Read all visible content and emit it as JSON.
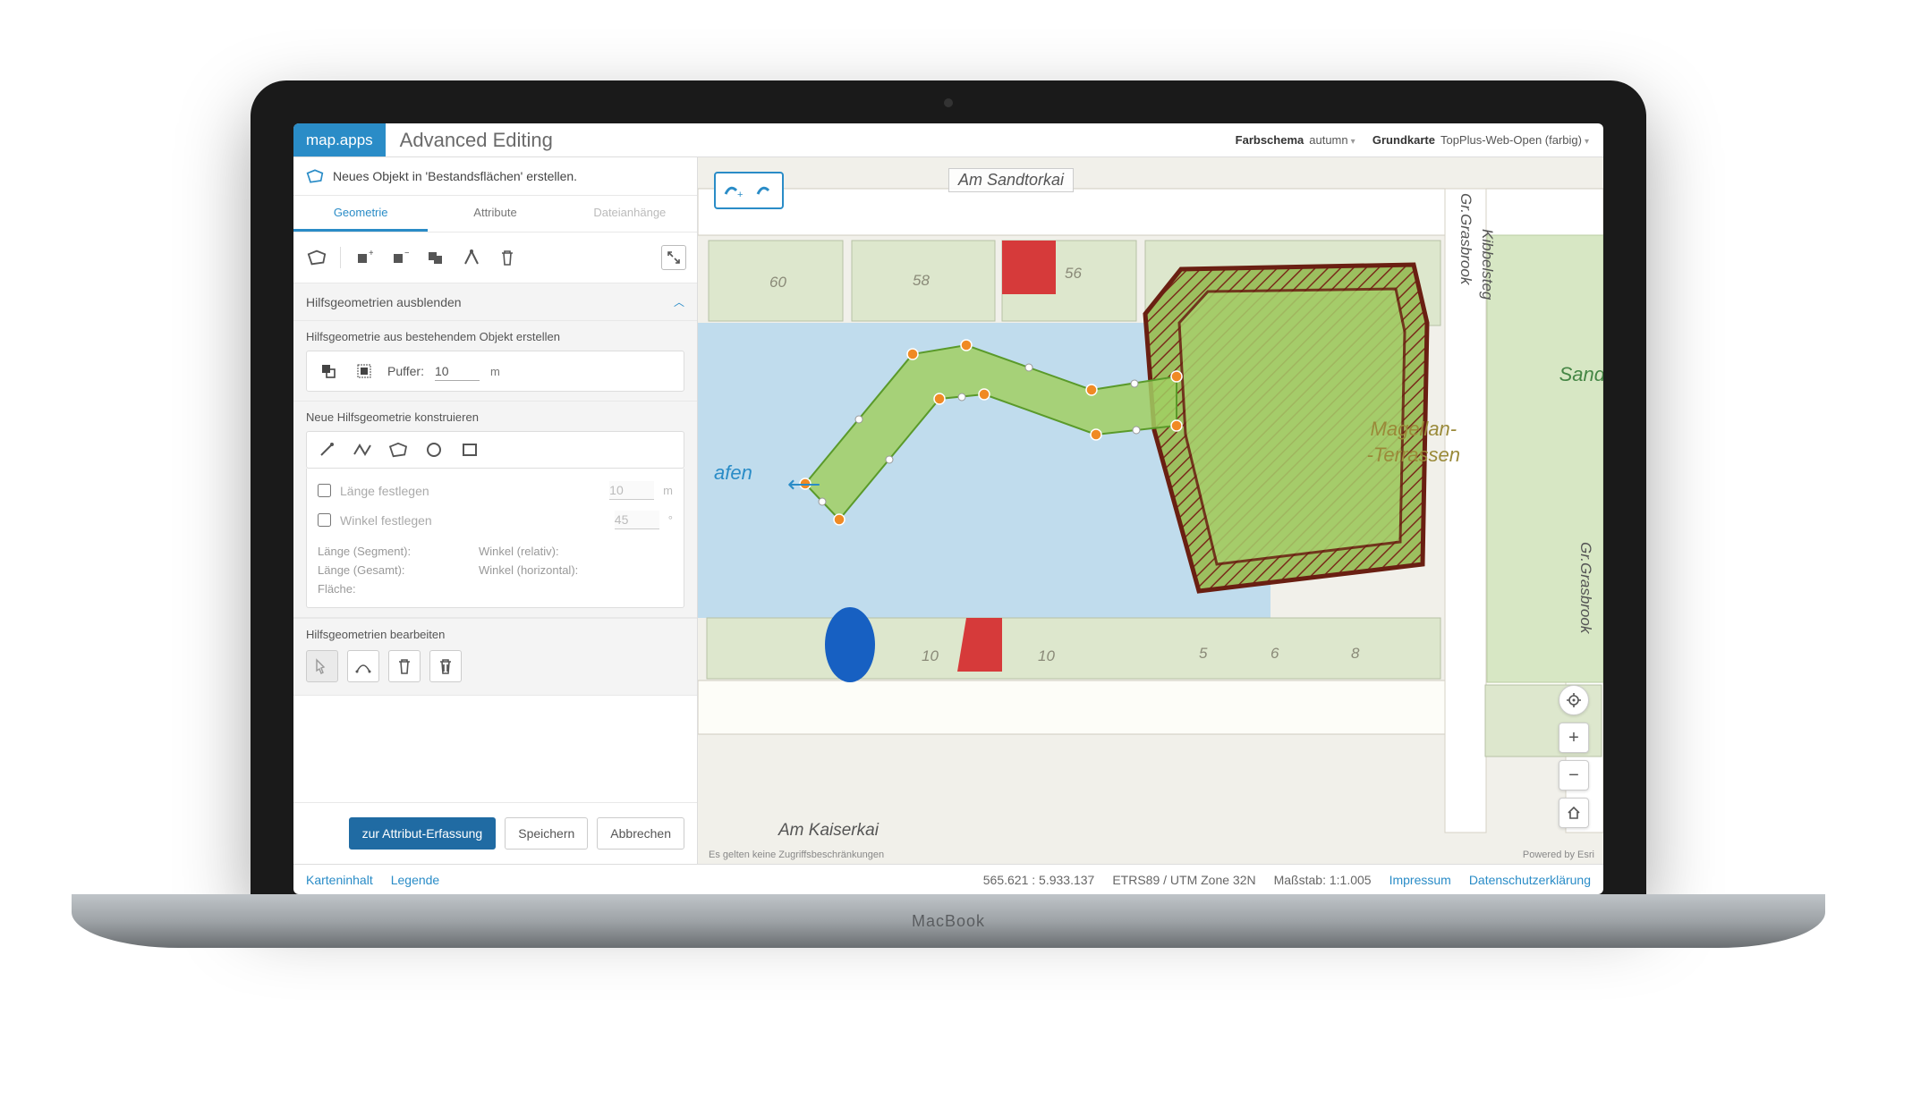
{
  "header": {
    "logo": "map.apps",
    "title": "Advanced Editing",
    "scheme_label": "Farbschema",
    "scheme_value": "autumn",
    "basemap_label": "Grundkarte",
    "basemap_value": "TopPlus-Web-Open (farbig)"
  },
  "panel": {
    "title": "Neues Objekt in 'Bestandsflächen' erstellen.",
    "tabs": {
      "geometry": "Geometrie",
      "attributes": "Attribute",
      "files": "Dateianhänge"
    },
    "hide_helpers": "Hilfsgeometrien ausblenden",
    "from_existing_head": "Hilfsgeometrie aus bestehendem Objekt erstellen",
    "buffer_label": "Puffer:",
    "buffer_value": "10",
    "buffer_unit": "m",
    "construct_head": "Neue Hilfsgeometrie konstruieren",
    "fix_length": "Länge festlegen",
    "fix_length_value": "10",
    "fix_length_unit": "m",
    "fix_angle": "Winkel festlegen",
    "fix_angle_value": "45",
    "fix_angle_unit": "°",
    "info": {
      "len_seg": "Länge (Segment):",
      "angle_rel": "Winkel (relativ):",
      "len_total": "Länge (Gesamt):",
      "angle_hor": "Winkel (horizontal):",
      "area": "Fläche:"
    },
    "edit_head": "Hilfsgeometrien bearbeiten",
    "actions": {
      "primary": "zur Attribut-Erfassung",
      "save": "Speichern",
      "cancel": "Abbrechen"
    }
  },
  "map": {
    "street_top": "Am Sandtorkai",
    "street_bottom": "Am Kaiserkai",
    "magellan_line1": "Magellan-",
    "magellan_line2": "-Terrassen",
    "sand": "Sand",
    "hafen": "afen",
    "street_right1": "Gr.Grasbrook",
    "street_right2": "Kibbelsteg",
    "street_right3": "Gr.Grasbrook",
    "building_numbers": [
      "60",
      "58",
      "56",
      "5",
      "6",
      "8",
      "10",
      "10"
    ],
    "note": "Es gelten keine Zugriffsbeschränkungen",
    "credit": "Powered by Esri"
  },
  "footer": {
    "content": "Karteninhalt",
    "legend": "Legende",
    "coord": "565.621 : 5.933.137",
    "crs": "ETRS89 / UTM Zone 32N",
    "scale_label": "Maßstab:",
    "scale_value": "1:1.005",
    "imprint": "Impressum",
    "privacy": "Datenschutzerklärung"
  }
}
